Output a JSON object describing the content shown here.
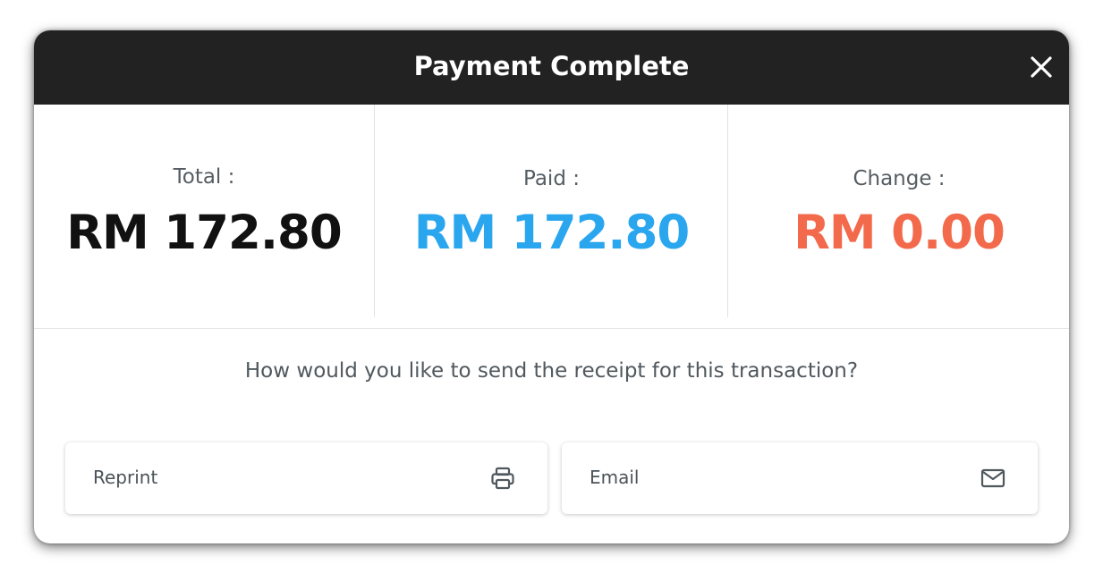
{
  "header": {
    "title": "Payment Complete",
    "close_icon": "close-icon"
  },
  "summary": {
    "total": {
      "label": "Total :",
      "amount": "RM 172.80"
    },
    "paid": {
      "label": "Paid :",
      "amount": "RM 172.80"
    },
    "change": {
      "label": "Change :",
      "amount": "RM 0.00"
    }
  },
  "receipt": {
    "question": "How would you like to send the receipt for this transaction?",
    "options": [
      {
        "label": "Reprint",
        "icon": "printer-icon"
      },
      {
        "label": "Email",
        "icon": "mail-icon"
      }
    ]
  },
  "colors": {
    "header_bg": "#222222",
    "paid": "#2aa6ef",
    "change": "#f26a4b",
    "total": "#111111"
  }
}
